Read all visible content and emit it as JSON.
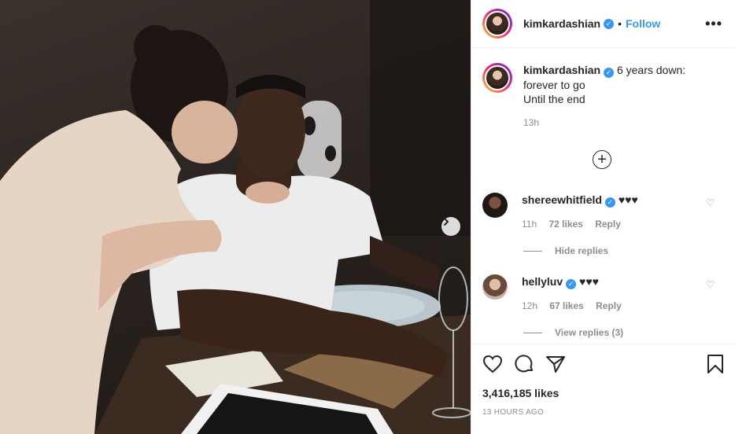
{
  "post": {
    "username": "kimkardashian",
    "follow_label": "Follow",
    "more_label": "•••",
    "separator": "•"
  },
  "caption": {
    "username": "kimkardashian",
    "line1": "6 years down:",
    "line2": "forever to go",
    "line3": "Until the end",
    "time": "13h"
  },
  "load_more_label": "+",
  "comments": [
    {
      "username": "sheree whitfield",
      "display_username": "shereewhitfield",
      "text": "♥♥♥",
      "time": "11h",
      "likes": "72 likes",
      "reply_label": "Reply",
      "replies_label": "Hide replies"
    },
    {
      "display_username": "hellyluv",
      "text": "♥♥♥",
      "time": "12h",
      "likes": "67 likes",
      "reply_label": "Reply",
      "replies_label": "View replies (3)"
    }
  ],
  "likes_count": "3,416,185 likes",
  "posted_ago": "13 HOURS AGO",
  "icons": {
    "like": "heart-icon",
    "comment": "comment-icon",
    "share": "share-icon",
    "save": "bookmark-icon",
    "next": "chevron-right-icon"
  },
  "colors": {
    "accent": "#3897f0",
    "muted": "#8e8e8e",
    "border": "#efefef",
    "text": "#262626"
  }
}
